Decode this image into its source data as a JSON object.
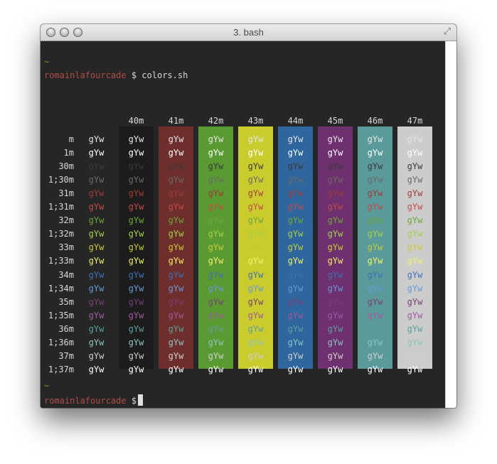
{
  "window": {
    "title": "3. bash"
  },
  "titlebar_icons": [
    "close-button",
    "minimize-button",
    "zoom-button",
    "fullscreen-icon"
  ],
  "terminal": {
    "tilde": "~",
    "prompt_user": "romainlafourcade",
    "prompt_symbol": "$",
    "command": "colors.sh",
    "headers": [
      "40m",
      "41m",
      "42m",
      "43m",
      "44m",
      "45m",
      "46m",
      "47m"
    ],
    "row_labels": [
      "m",
      "1m",
      "30m",
      "1;30m",
      "31m",
      "1;31m",
      "32m",
      "1;32m",
      "33m",
      "1;33m",
      "34m",
      "1;34m",
      "35m",
      "1;35m",
      "36m",
      "1;36m",
      "37m",
      "1;37m"
    ],
    "sample": "gYw",
    "background_colors": [
      "#1c1c1c",
      "#6e2e2c",
      "#5a9a32",
      "#c9cc2c",
      "#2f669e",
      "#6e306e",
      "#5b9a9a",
      "#cccccc"
    ],
    "foreground_colors": {
      "m": "#e5e5e5",
      "1m": "#ffffff",
      "30m": "#3a3a3a",
      "1;30m": "#6a6a6a",
      "31m": "#9e3b38",
      "1;31m": "#c44b47",
      "32m": "#6da63a",
      "1;32m": "#a3d04c",
      "33m": "#c8c83a",
      "1;33m": "#f0f06a",
      "34m": "#3f6fb4",
      "1;34m": "#6a98d8",
      "35m": "#7a3f7a",
      "1;35m": "#a05aa0",
      "36m": "#5e9e9e",
      "1;36m": "#8cc4c4",
      "37m": "#cfcfcf",
      "1;37m": "#ffffff"
    },
    "final_prompt_user": "romainlafourcade",
    "final_prompt_symbol": "$"
  }
}
